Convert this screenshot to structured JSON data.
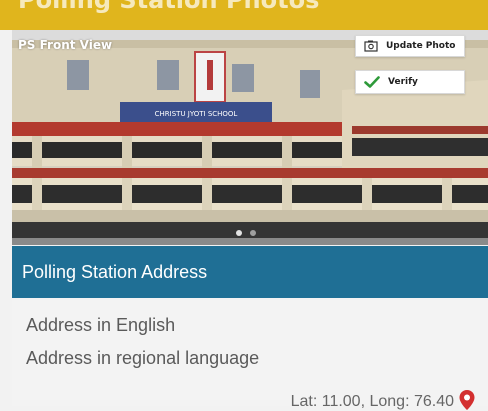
{
  "header": {
    "title": "Polling Station Photos"
  },
  "photo": {
    "label": "PS Front View",
    "sign_text": "CHRISTU JYOTI SCHOOL",
    "actions": {
      "update_label": "Update Photo",
      "verify_label": "Verify"
    },
    "carousel": {
      "count": 2,
      "active_index": 0
    }
  },
  "address_section": {
    "title": "Polling Station Address",
    "english_placeholder": "Address in English",
    "regional_placeholder": "Address in regional language",
    "coordinates": "Lat: 11.00, Long: 76.40"
  },
  "icons": {
    "update": "photo-icon",
    "verify": "check-icon",
    "location": "map-pin-icon"
  },
  "colors": {
    "header": "#e0b51d",
    "section_header": "#1f6f95",
    "verify_check": "#2e9a3a",
    "location_pin": "#d32f2f"
  }
}
